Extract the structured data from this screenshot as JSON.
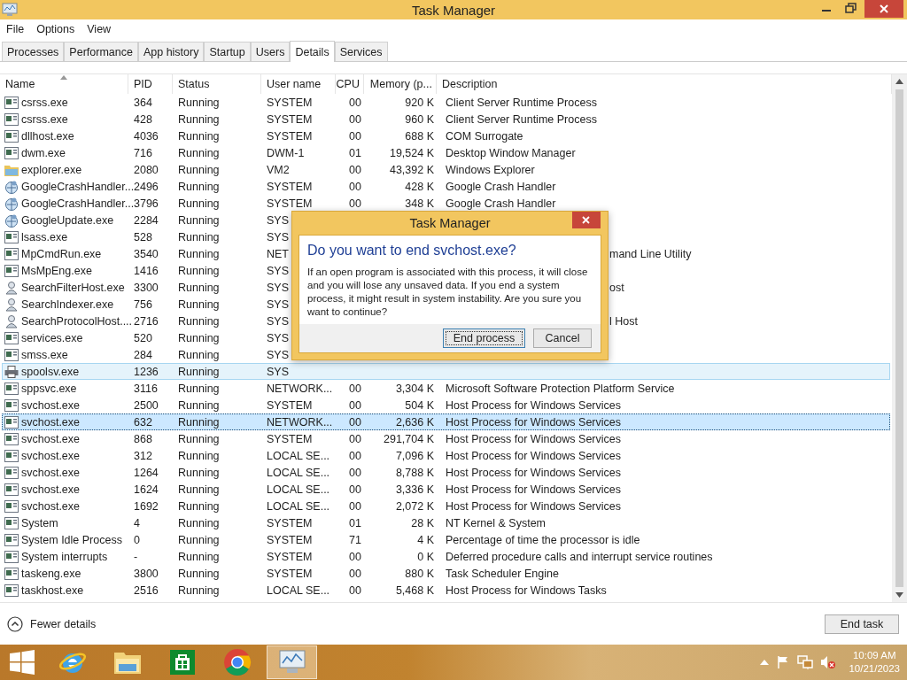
{
  "window": {
    "title": "Task Manager"
  },
  "menu": [
    "File",
    "Options",
    "View"
  ],
  "tabs": [
    {
      "label": "Processes",
      "selected": false
    },
    {
      "label": "Performance",
      "selected": false
    },
    {
      "label": "App history",
      "selected": false
    },
    {
      "label": "Startup",
      "selected": false
    },
    {
      "label": "Users",
      "selected": false
    },
    {
      "label": "Details",
      "selected": true
    },
    {
      "label": "Services",
      "selected": false
    }
  ],
  "table": {
    "columns": [
      {
        "label": "Name",
        "sorted": true
      },
      {
        "label": "PID",
        "sorted": false
      },
      {
        "label": "Status",
        "sorted": false
      },
      {
        "label": "User name",
        "sorted": false
      },
      {
        "label": "CPU",
        "sorted": false
      },
      {
        "label": "Memory (p...",
        "sorted": false
      },
      {
        "label": "Description",
        "sorted": false
      }
    ],
    "rows": [
      {
        "kind": "app",
        "name": "csrss.exe",
        "pid": "364",
        "status": "Running",
        "user": "SYSTEM",
        "cpu": "00",
        "memory": "920 K",
        "description": "Client Server Runtime Process",
        "selected": false,
        "hovered": false
      },
      {
        "kind": "app",
        "name": "csrss.exe",
        "pid": "428",
        "status": "Running",
        "user": "SYSTEM",
        "cpu": "00",
        "memory": "960 K",
        "description": "Client Server Runtime Process",
        "selected": false,
        "hovered": false
      },
      {
        "kind": "app",
        "name": "dllhost.exe",
        "pid": "4036",
        "status": "Running",
        "user": "SYSTEM",
        "cpu": "00",
        "memory": "688 K",
        "description": "COM Surrogate",
        "selected": false,
        "hovered": false
      },
      {
        "kind": "app",
        "name": "dwm.exe",
        "pid": "716",
        "status": "Running",
        "user": "DWM-1",
        "cpu": "01",
        "memory": "19,524 K",
        "description": "Desktop Window Manager",
        "selected": false,
        "hovered": false
      },
      {
        "kind": "folder",
        "name": "explorer.exe",
        "pid": "2080",
        "status": "Running",
        "user": "VM2",
        "cpu": "00",
        "memory": "43,392 K",
        "description": "Windows Explorer",
        "selected": false,
        "hovered": false
      },
      {
        "kind": "globe",
        "name": "GoogleCrashHandler...",
        "pid": "2496",
        "status": "Running",
        "user": "SYSTEM",
        "cpu": "00",
        "memory": "428 K",
        "description": "Google Crash Handler",
        "selected": false,
        "hovered": false
      },
      {
        "kind": "globe",
        "name": "GoogleCrashHandler...",
        "pid": "3796",
        "status": "Running",
        "user": "SYSTEM",
        "cpu": "00",
        "memory": "348 K",
        "description": "Google Crash Handler",
        "selected": false,
        "hovered": false
      },
      {
        "kind": "globe",
        "name": "GoogleUpdate.exe",
        "pid": "2284",
        "status": "Running",
        "user": "SYS",
        "selected": false,
        "hovered": false
      },
      {
        "kind": "app",
        "name": "lsass.exe",
        "pid": "528",
        "status": "Running",
        "user": "SYS",
        "selected": false,
        "hovered": false
      },
      {
        "kind": "app",
        "name": "MpCmdRun.exe",
        "pid": "3540",
        "status": "Running",
        "user": "NET",
        "description_tail": "mand Line Utility",
        "selected": false,
        "hovered": false
      },
      {
        "kind": "app",
        "name": "MsMpEng.exe",
        "pid": "1416",
        "status": "Running",
        "user": "SYS",
        "selected": false,
        "hovered": false
      },
      {
        "kind": "person",
        "name": "SearchFilterHost.exe",
        "pid": "3300",
        "status": "Running",
        "user": "SYS",
        "description_tail": "ost",
        "selected": false,
        "hovered": false
      },
      {
        "kind": "person",
        "name": "SearchIndexer.exe",
        "pid": "756",
        "status": "Running",
        "user": "SYS",
        "selected": false,
        "hovered": false
      },
      {
        "kind": "person",
        "name": "SearchProtocolHost....",
        "pid": "2716",
        "status": "Running",
        "user": "SYS",
        "description_tail": "l Host",
        "selected": false,
        "hovered": false
      },
      {
        "kind": "app",
        "name": "services.exe",
        "pid": "520",
        "status": "Running",
        "user": "SYS",
        "selected": false,
        "hovered": false
      },
      {
        "kind": "app",
        "name": "smss.exe",
        "pid": "284",
        "status": "Running",
        "user": "SYS",
        "selected": false,
        "hovered": false
      },
      {
        "kind": "printer",
        "name": "spoolsv.exe",
        "pid": "1236",
        "status": "Running",
        "user": "SYS",
        "selected": false,
        "hovered": true
      },
      {
        "kind": "app",
        "name": "sppsvc.exe",
        "pid": "3116",
        "status": "Running",
        "user": "NETWORK...",
        "cpu": "00",
        "memory": "3,304 K",
        "description": "Microsoft Software Protection Platform Service",
        "selected": false,
        "hovered": false
      },
      {
        "kind": "app",
        "name": "svchost.exe",
        "pid": "2500",
        "status": "Running",
        "user": "SYSTEM",
        "cpu": "00",
        "memory": "504 K",
        "description": "Host Process for Windows Services",
        "selected": false,
        "hovered": false
      },
      {
        "kind": "app",
        "name": "svchost.exe",
        "pid": "632",
        "status": "Running",
        "user": "NETWORK...",
        "cpu": "00",
        "memory": "2,636 K",
        "description": "Host Process for Windows Services",
        "selected": true,
        "hovered": false
      },
      {
        "kind": "app",
        "name": "svchost.exe",
        "pid": "868",
        "status": "Running",
        "user": "SYSTEM",
        "cpu": "00",
        "memory": "291,704 K",
        "description": "Host Process for Windows Services",
        "selected": false,
        "hovered": false
      },
      {
        "kind": "app",
        "name": "svchost.exe",
        "pid": "312",
        "status": "Running",
        "user": "LOCAL SE...",
        "cpu": "00",
        "memory": "7,096 K",
        "description": "Host Process for Windows Services",
        "selected": false,
        "hovered": false
      },
      {
        "kind": "app",
        "name": "svchost.exe",
        "pid": "1264",
        "status": "Running",
        "user": "LOCAL SE...",
        "cpu": "00",
        "memory": "8,788 K",
        "description": "Host Process for Windows Services",
        "selected": false,
        "hovered": false
      },
      {
        "kind": "app",
        "name": "svchost.exe",
        "pid": "1624",
        "status": "Running",
        "user": "LOCAL SE...",
        "cpu": "00",
        "memory": "3,336 K",
        "description": "Host Process for Windows Services",
        "selected": false,
        "hovered": false
      },
      {
        "kind": "app",
        "name": "svchost.exe",
        "pid": "1692",
        "status": "Running",
        "user": "LOCAL SE...",
        "cpu": "00",
        "memory": "2,072 K",
        "description": "Host Process for Windows Services",
        "selected": false,
        "hovered": false
      },
      {
        "kind": "app",
        "name": "System",
        "pid": "4",
        "status": "Running",
        "user": "SYSTEM",
        "cpu": "01",
        "memory": "28 K",
        "description": "NT Kernel & System",
        "selected": false,
        "hovered": false
      },
      {
        "kind": "app",
        "name": "System Idle Process",
        "pid": "0",
        "status": "Running",
        "user": "SYSTEM",
        "cpu": "71",
        "memory": "4 K",
        "description": "Percentage of time the processor is idle",
        "selected": false,
        "hovered": false
      },
      {
        "kind": "app",
        "name": "System interrupts",
        "pid": "-",
        "status": "Running",
        "user": "SYSTEM",
        "cpu": "00",
        "memory": "0 K",
        "description": "Deferred procedure calls and interrupt service routines",
        "selected": false,
        "hovered": false
      },
      {
        "kind": "app",
        "name": "taskeng.exe",
        "pid": "3800",
        "status": "Running",
        "user": "SYSTEM",
        "cpu": "00",
        "memory": "880 K",
        "description": "Task Scheduler Engine",
        "selected": false,
        "hovered": false
      },
      {
        "kind": "app",
        "name": "taskhost.exe",
        "pid": "2516",
        "status": "Running",
        "user": "LOCAL SE...",
        "cpu": "00",
        "memory": "5,468 K",
        "description": "Host Process for Windows Tasks",
        "selected": false,
        "hovered": false
      }
    ]
  },
  "footer": {
    "toggle": "Fewer details",
    "button": "End task"
  },
  "dialog": {
    "title": "Task Manager",
    "heading": "Do you want to end svchost.exe?",
    "message": "If an open program is associated with this process, it will close and you will lose any unsaved data. If you end a system process, it might result in system instability. Are you sure you want to continue?",
    "buttons": [
      {
        "label": "End process",
        "default": true
      },
      {
        "label": "Cancel",
        "default": false
      }
    ]
  },
  "taskbar": {
    "apps": [
      {
        "kind": "browser",
        "active": false
      },
      {
        "kind": "folder",
        "active": false
      },
      {
        "kind": "store",
        "active": false
      },
      {
        "kind": "chrome",
        "active": false
      },
      {
        "kind": "monitor",
        "active": true
      }
    ],
    "time": "10:09 AM",
    "date": "10/21/2023"
  }
}
